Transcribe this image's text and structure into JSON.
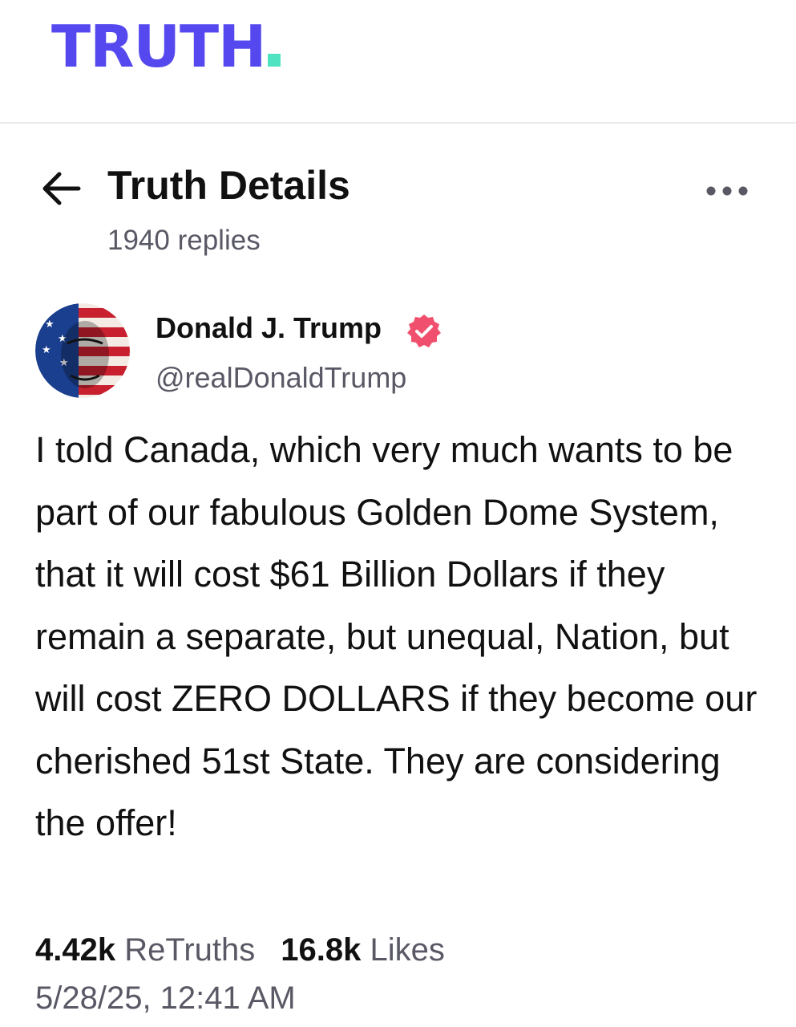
{
  "app": {
    "logo_text": "TRUTH"
  },
  "header": {
    "title": "Truth Details",
    "replies": "1940 replies"
  },
  "post": {
    "author_name": "Donald J. Trump",
    "handle": "@realDonaldTrump",
    "text": "I told Canada, which very much wants to be part of our fabulous Golden Dome System, that it will cost $61 Billion Dollars if they remain a separate, but unequal, Nation, but will cost ZERO DOLLARS if they become our cherished 51st State. They are considering the offer!",
    "retruths_count": "4.42k",
    "retruths_label": "ReTruths",
    "likes_count": "16.8k",
    "likes_label": "Likes",
    "timestamp": "5/28/25, 12:41 AM"
  },
  "icons": {
    "back": "arrow-left-icon",
    "more": "more-dots-icon",
    "verified": "verified-badge-icon"
  },
  "colors": {
    "brand": "#5448ee",
    "brand_accent": "#4fe3c2",
    "verified_badge": "#f0506e",
    "secondary_text": "#595966"
  }
}
